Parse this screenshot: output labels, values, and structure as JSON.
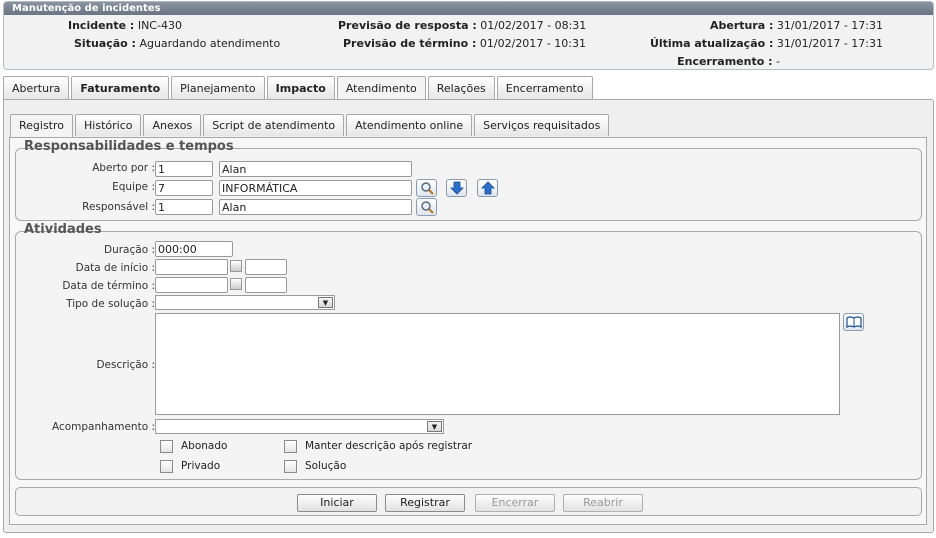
{
  "window": {
    "title": "Manutenção de incidentes"
  },
  "header": {
    "incidente_label": "Incidente :",
    "incidente_value": "INC-430",
    "situacao_label": "Situação :",
    "situacao_value": "Aguardando atendimento",
    "prev_resposta_label": "Previsão de resposta :",
    "prev_resposta_value": "01/02/2017 - 08:31",
    "prev_termino_label": "Previsão de término :",
    "prev_termino_value": "01/02/2017 - 10:31",
    "abertura_label": "Abertura :",
    "abertura_value": "31/01/2017 - 17:31",
    "ultima_label": "Última atualização :",
    "ultima_value": "31/01/2017 - 17:31",
    "encerramento_label": "Encerramento :",
    "encerramento_value": "-"
  },
  "outer_tabs": [
    "Abertura",
    "Faturamento",
    "Planejamento",
    "Impacto",
    "Atendimento",
    "Relações",
    "Encerramento"
  ],
  "inner_tabs": [
    "Registro",
    "Histórico",
    "Anexos",
    "Script de atendimento",
    "Atendimento online",
    "Serviços requisitados"
  ],
  "responsabilidades": {
    "legend": "Responsabilidades e tempos",
    "aberto_por_label": "Aberto por :",
    "aberto_por_code": "1",
    "aberto_por_name": "Alan",
    "equipe_label": "Equipe :",
    "equipe_code": "7",
    "equipe_name": "INFORMÁTICA",
    "responsavel_label": "Responsável :",
    "responsavel_code": "1",
    "responsavel_name": "Alan"
  },
  "atividades": {
    "legend": "Atividades",
    "duracao_label": "Duração :",
    "duracao_value": "000:00",
    "data_inicio_label": "Data de início :",
    "data_termino_label": "Data de término :",
    "tipo_solucao_label": "Tipo de solução :",
    "descricao_label": "Descrição :",
    "acompanhamento_label": "Acompanhamento :",
    "abonado_label": "Abonado",
    "privado_label": "Privado",
    "manter_label": "Manter descrição após registrar",
    "solucao_label": "Solução"
  },
  "buttons": {
    "iniciar": "Iniciar",
    "registrar": "Registrar",
    "encerrar": "Encerrar",
    "reabrir": "Reabrir"
  },
  "colors": {
    "title_bar": "#6a7482",
    "icon_blue": "#2a6fc9"
  }
}
